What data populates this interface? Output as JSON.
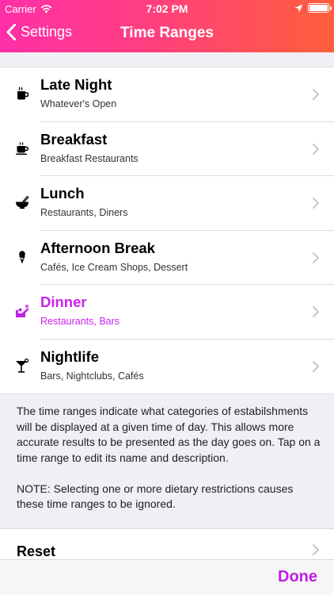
{
  "status_bar": {
    "carrier": "Carrier",
    "time": "7:02 PM"
  },
  "nav": {
    "back_label": "Settings",
    "title": "Time Ranges"
  },
  "time_ranges": [
    {
      "name": "Late Night",
      "description": "Whatever's Open",
      "icon": "coffee-cup-icon",
      "selected": false
    },
    {
      "name": "Breakfast",
      "description": "Breakfast Restaurants",
      "icon": "coffee-mug-icon",
      "selected": false
    },
    {
      "name": "Lunch",
      "description": "Restaurants, Diners",
      "icon": "bowl-icon",
      "selected": false
    },
    {
      "name": "Afternoon Break",
      "description": "Cafés, Ice Cream Shops, Dessert",
      "icon": "ice-cream-icon",
      "selected": false
    },
    {
      "name": "Dinner",
      "description": "Restaurants, Bars",
      "icon": "dinner-service-icon",
      "selected": true
    },
    {
      "name": "Nightlife",
      "description": "Bars, Nightclubs, Cafés",
      "icon": "cocktail-icon",
      "selected": false
    }
  ],
  "footer_note": {
    "paragraph1": "The time ranges indicate what categories of estabilshments will be displayed at a given time of day. This allows more accurate results to be presented as the day goes on. Tap on a time range to edit its name and description.",
    "paragraph2": "NOTE: Selecting one or more dietary restrictions causes these time ranges to be ignored."
  },
  "reset": {
    "label": "Reset"
  },
  "toolbar": {
    "done_label": "Done"
  },
  "colors": {
    "accent": "#c11de6",
    "nav_gradient_start": "#ff2fa8",
    "nav_gradient_end": "#ff5f3a",
    "background": "#efeff4"
  }
}
